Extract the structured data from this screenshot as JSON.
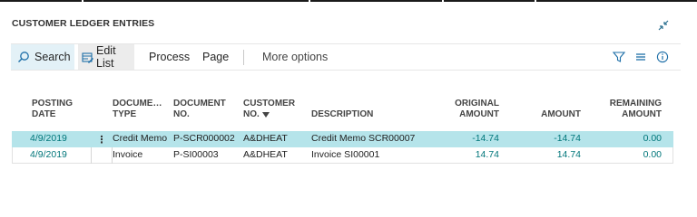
{
  "page": {
    "title": "CUSTOMER LEDGER ENTRIES"
  },
  "actionbar": {
    "search_label": "Search",
    "edit_list_label": "Edit List",
    "process_label": "Process",
    "page_label": "Page",
    "more_options_label": "More options"
  },
  "table": {
    "columns": {
      "posting_date": [
        "POSTING",
        "DATE"
      ],
      "document_type": [
        "DOCUME…",
        "TYPE"
      ],
      "document_no": [
        "DOCUMENT",
        "NO."
      ],
      "customer_no": [
        "CUSTOMER",
        "NO."
      ],
      "description": "DESCRIPTION",
      "original_amount": [
        "ORIGINAL",
        "AMOUNT"
      ],
      "amount": "AMOUNT",
      "remaining_amount": [
        "REMAINING",
        "AMOUNT"
      ]
    },
    "rows": [
      {
        "posting_date": "4/9/2019",
        "document_type": "Credit Memo",
        "document_no": "P-SCR000002",
        "customer_no": "A&DHEAT",
        "description": "Credit Memo SCR00007",
        "original_amount": "-14.74",
        "amount": "-14.74",
        "remaining_amount": "0.00",
        "selected": true
      },
      {
        "posting_date": "4/9/2019",
        "document_type": "Invoice",
        "document_no": "P-SI00003",
        "customer_no": "A&DHEAT",
        "description": "Invoice SI00001",
        "original_amount": "14.74",
        "amount": "14.74",
        "remaining_amount": "0.00",
        "selected": false
      }
    ]
  },
  "icons": {
    "collapse": "collapse-arrows-icon",
    "search": "search-icon",
    "edit_list": "edit-list-icon",
    "filter": "filter-icon",
    "list_view": "list-view-icon",
    "info": "info-icon",
    "row_menu": "row-actions-icon"
  },
  "colors": {
    "accent": "#00767a",
    "selected_row": "#b5e4ea",
    "search_bg": "#e3f1f7"
  }
}
